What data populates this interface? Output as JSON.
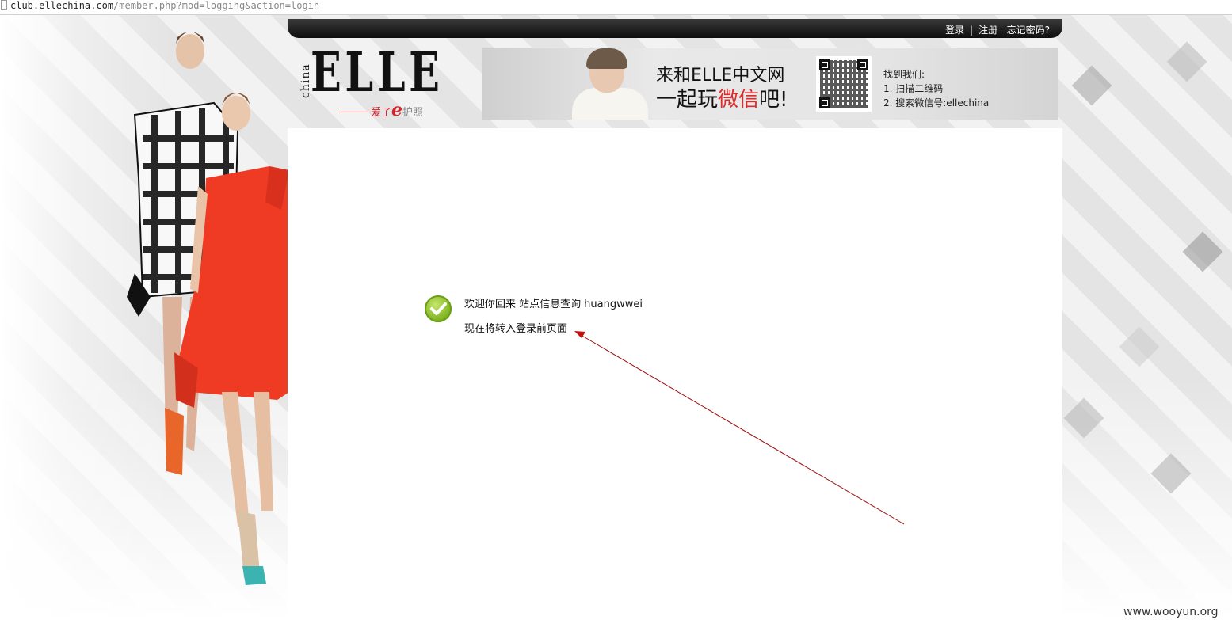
{
  "browser": {
    "url_host": "club.ellechina.com",
    "url_path": "/member.php?mod=logging&action=login"
  },
  "header": {
    "links": [
      "登录",
      "注册",
      "忘记密码?"
    ],
    "separator": "|"
  },
  "logo": {
    "brand": "ELLE",
    "side_text": "china",
    "tagline_prefix": "爱了",
    "tagline_e": "e",
    "tagline_suffix": "护照"
  },
  "banner": {
    "line1": "来和ELLE中文网",
    "line2_prefix": "一起玩",
    "line2_highlight": "微信",
    "line2_suffix": "吧!",
    "find_us_title": "找到我们:",
    "find_us_step1": "1. 扫描二维码",
    "find_us_step2": "2. 搜索微信号:ellechina"
  },
  "message": {
    "welcome": "欢迎你回来 站点信息查询",
    "username": "huangwwei",
    "redirect": "现在将转入登录前页面"
  },
  "watermark": "www.wooyun.org",
  "colors": {
    "accent_red": "#d2232a",
    "arrow_red": "#a01010",
    "check_green": "#7ab01e"
  }
}
